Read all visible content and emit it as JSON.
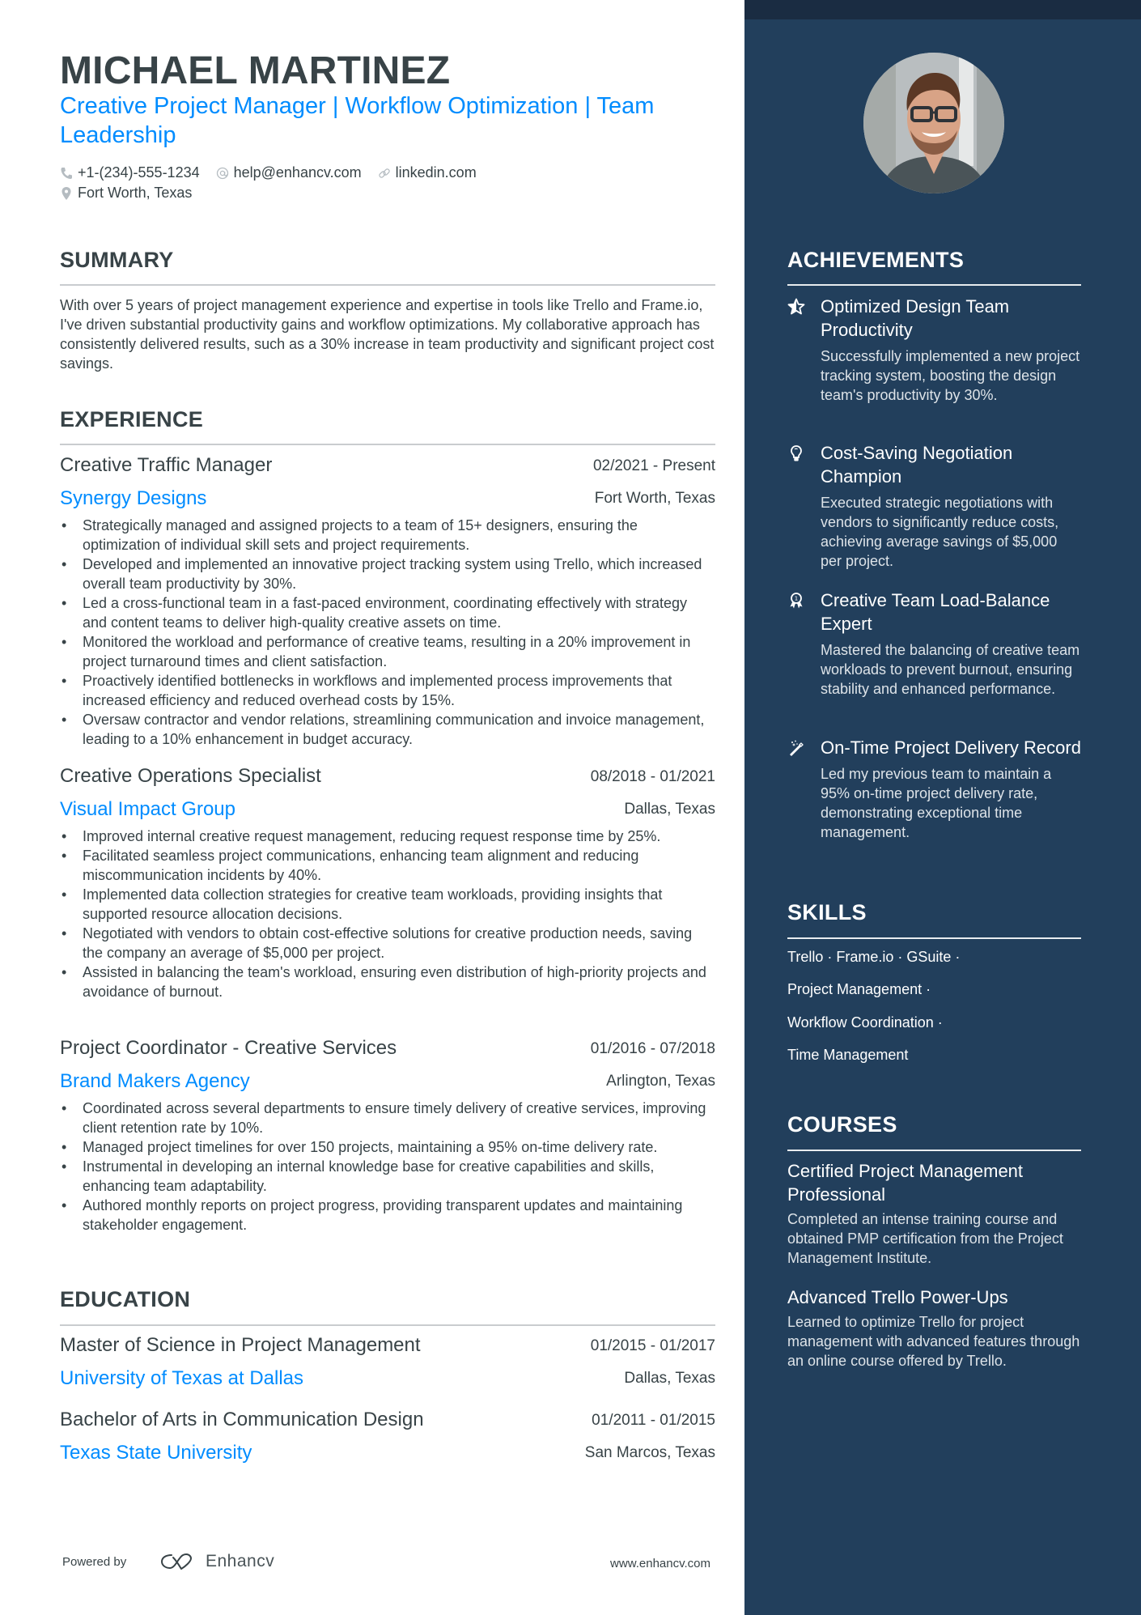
{
  "header": {
    "name": "MICHAEL MARTINEZ",
    "subtitle": "Creative Project Manager | Workflow Optimization | Team Leadership",
    "contacts": [
      {
        "icon": "phone-icon",
        "text": "+1-(234)-555-1234"
      },
      {
        "icon": "at-icon",
        "text": "help@enhancv.com"
      },
      {
        "icon": "link-icon",
        "text": "linkedin.com"
      }
    ],
    "location": {
      "icon": "location-pin-icon",
      "text": "Fort Worth, Texas"
    }
  },
  "summary": {
    "title": "SUMMARY",
    "text": "With over 5 years of project management experience and expertise in tools like Trello and Frame.io, I've driven substantial productivity gains and workflow optimizations. My collaborative approach has consistently delivered results, such as a 30% increase in team productivity and significant project cost savings."
  },
  "experience": {
    "title": "EXPERIENCE",
    "jobs": [
      {
        "title": "Creative Traffic Manager",
        "dates": "02/2021 - Present",
        "company": "Synergy Designs",
        "location": "Fort Worth, Texas",
        "bullets": [
          "Strategically managed and assigned projects to a team of 15+ designers, ensuring the optimization of individual skill sets and project requirements.",
          "Developed and implemented an innovative project tracking system using Trello, which increased overall team productivity by 30%.",
          "Led a cross-functional team in a fast-paced environment, coordinating effectively with strategy and content teams to deliver high-quality creative assets on time.",
          "Monitored the workload and performance of creative teams, resulting in a 20% improvement in project turnaround times and client satisfaction.",
          "Proactively identified bottlenecks in workflows and implemented process improvements that increased efficiency and reduced overhead costs by 15%.",
          "Oversaw contractor and vendor relations, streamlining communication and invoice management, leading to a 10% enhancement in budget accuracy."
        ]
      },
      {
        "title": "Creative Operations Specialist",
        "dates": "08/2018 - 01/2021",
        "company": "Visual Impact Group",
        "location": "Dallas, Texas",
        "bullets": [
          "Improved internal creative request management, reducing request response time by 25%.",
          "Facilitated seamless project communications, enhancing team alignment and reducing miscommunication incidents by 40%.",
          "Implemented data collection strategies for creative team workloads, providing insights that supported resource allocation decisions.",
          "Negotiated with vendors to obtain cost-effective solutions for creative production needs, saving the company an average of $5,000 per project.",
          "Assisted in balancing the team's workload, ensuring even distribution of high-priority projects and avoidance of burnout."
        ]
      },
      {
        "title": "Project Coordinator - Creative Services",
        "dates": "01/2016 - 07/2018",
        "company": "Brand Makers Agency",
        "location": "Arlington, Texas",
        "bullets": [
          "Coordinated across several departments to ensure timely delivery of creative services, improving client retention rate by 10%.",
          "Managed project timelines for over 150 projects, maintaining a 95% on-time delivery rate.",
          "Instrumental in developing an internal knowledge base for creative capabilities and skills, enhancing team adaptability.",
          "Authored monthly reports on project progress, providing transparent updates and maintaining stakeholder engagement."
        ]
      }
    ]
  },
  "education": {
    "title": "EDUCATION",
    "items": [
      {
        "degree": "Master of Science in Project Management",
        "dates": "01/2015 - 01/2017",
        "school": "University of Texas at Dallas",
        "location": "Dallas, Texas"
      },
      {
        "degree": "Bachelor of Arts in Communication Design",
        "dates": "01/2011 - 01/2015",
        "school": "Texas State University",
        "location": "San Marcos, Texas"
      }
    ]
  },
  "footer": {
    "powered_by": "Powered by",
    "brand": "Enhancv",
    "website": "www.enhancv.com"
  },
  "sidebar": {
    "achievements": {
      "title": "ACHIEVEMENTS",
      "items": [
        {
          "icon": "star-icon",
          "title": "Optimized Design Team Productivity",
          "desc": "Successfully implemented a new project tracking system, boosting the design team's productivity by 30%."
        },
        {
          "icon": "lightbulb-icon",
          "title": "Cost-Saving Negotiation Champion",
          "desc": "Executed strategic negotiations with vendors to significantly reduce costs, achieving average savings of $5,000 per project."
        },
        {
          "icon": "award-ribbon-icon",
          "title": "Creative Team Load-Balance Expert",
          "desc": "Mastered the balancing of creative team workloads to prevent burnout, ensuring stability and enhanced performance."
        },
        {
          "icon": "magic-wand-icon",
          "title": "On-Time Project Delivery Record",
          "desc": "Led my previous team to maintain a 95% on-time project delivery rate, demonstrating exceptional time management."
        }
      ]
    },
    "skills": {
      "title": "SKILLS",
      "lines": [
        "Trello · Frame.io · GSuite ·",
        "Project Management ·",
        "Workflow Coordination ·",
        "Time Management"
      ]
    },
    "courses": {
      "title": "COURSES",
      "items": [
        {
          "title": "Certified Project Management Professional",
          "desc": "Completed an intense training course and obtained PMP certification from the Project Management Institute."
        },
        {
          "title": "Advanced Trello Power-Ups",
          "desc": "Learned to optimize Trello for project management with advanced features through an online course offered by Trello."
        }
      ]
    }
  },
  "colors": {
    "accent": "#008cff",
    "text": "#384347",
    "sidebar_bg": "#223f5c",
    "sidebar_strip": "#1a2c42"
  }
}
